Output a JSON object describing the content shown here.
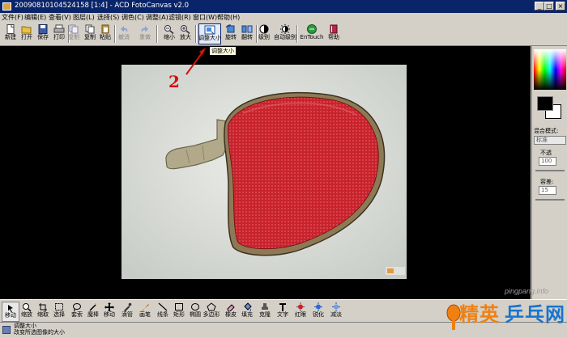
{
  "window": {
    "title": "20090810104524158 [1:4] - ACD FotoCanvas v2.0",
    "controls": [
      "_",
      "□",
      "×"
    ]
  },
  "menu": [
    "文件(F)",
    "编辑(E)",
    "查看(V)",
    "图层(L)",
    "选择(S)",
    "调色(C)",
    "调整(A)",
    "滤镜(R)",
    "窗口(W)",
    "帮助(H)"
  ],
  "toolbar": [
    {
      "label": "新建",
      "icon": "new-file-icon"
    },
    {
      "label": "打开",
      "icon": "open-folder-icon"
    },
    {
      "label": "保存",
      "icon": "save-icon"
    },
    {
      "label": "打印",
      "icon": "print-icon"
    },
    {
      "label": "复制",
      "icon": "copy-icon"
    },
    {
      "label": "复制",
      "icon": "copy-icon"
    },
    {
      "label": "粘贴",
      "icon": "paste-icon"
    },
    {
      "label": "撤消",
      "icon": "undo-icon"
    },
    {
      "label": "重做",
      "icon": "redo-icon"
    },
    {
      "label": "缩小",
      "icon": "zoom-out-icon"
    },
    {
      "label": "放大",
      "icon": "zoom-in-icon"
    },
    {
      "label": "调整大小",
      "icon": "resize-icon"
    },
    {
      "label": "旋转",
      "icon": "rotate-icon"
    },
    {
      "label": "翻转",
      "icon": "flip-icon"
    },
    {
      "label": "级别",
      "icon": "levels-icon"
    },
    {
      "label": "自动级别",
      "icon": "auto-levels-icon"
    },
    {
      "label": "EnTouch",
      "icon": "entouch-icon"
    },
    {
      "label": "帮助",
      "icon": "help-book-icon"
    }
  ],
  "tooltip": "调整大小",
  "annotation": "2",
  "right_panel": {
    "blend_label": "混合模式:",
    "blend_value": "标准",
    "opacity_label": "不透",
    "opacity_value": "100",
    "tolerance_label": "容差:",
    "tolerance_value": "15"
  },
  "tools": [
    {
      "label": "移动",
      "icon": "move-tool-icon"
    },
    {
      "label": "缩放",
      "icon": "zoom-tool-icon"
    },
    {
      "label": "缩取",
      "icon": "crop-tool-icon"
    },
    {
      "label": "选择",
      "icon": "rect-select-icon"
    },
    {
      "label": "套索",
      "icon": "lasso-icon"
    },
    {
      "label": "魔棒",
      "icon": "magic-wand-icon"
    },
    {
      "label": "移动",
      "icon": "move-arrows-icon"
    },
    {
      "label": "滴管",
      "icon": "eyedropper-icon"
    },
    {
      "label": "画笔",
      "icon": "brush-icon"
    },
    {
      "label": "线条",
      "icon": "line-icon"
    },
    {
      "label": "矩形",
      "icon": "rectangle-icon"
    },
    {
      "label": "椭圆",
      "icon": "ellipse-icon"
    },
    {
      "label": "多边形",
      "icon": "polygon-icon"
    },
    {
      "label": "橡皮",
      "icon": "eraser-icon"
    },
    {
      "label": "填充",
      "icon": "fill-icon"
    },
    {
      "label": "克隆",
      "icon": "clone-stamp-icon"
    },
    {
      "label": "文字",
      "icon": "text-tool-icon"
    },
    {
      "label": "红眼",
      "icon": "red-eye-icon"
    },
    {
      "label": "锐化",
      "icon": "sharpen-icon"
    },
    {
      "label": "减淡",
      "icon": "dodge-icon"
    }
  ],
  "status": {
    "title": "调整大小",
    "description": "改变所选图像的大小"
  },
  "watermark": {
    "url": "pingpang.info",
    "brand_part1": "精英",
    "brand_part2": "乒乓网"
  },
  "colors": {
    "title_bar": "#0a246a",
    "annotation_red": "#d01010",
    "paddle_red": "#c8232d",
    "brand_orange": "#f08010",
    "brand_blue": "#1874cd"
  }
}
